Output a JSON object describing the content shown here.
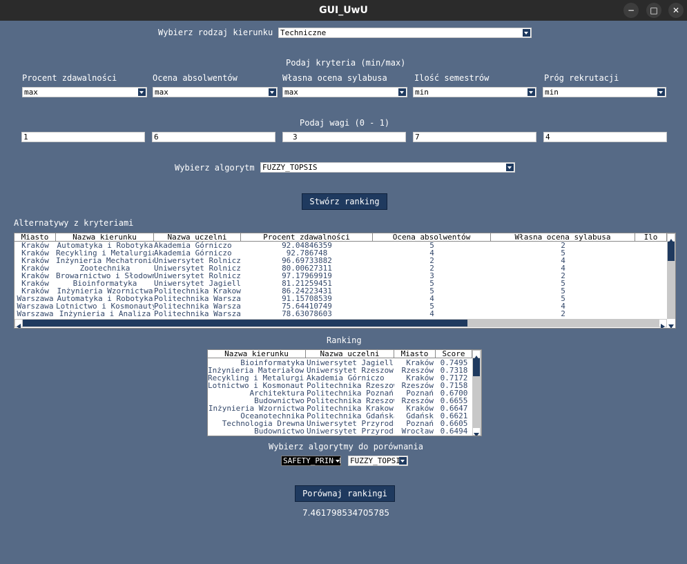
{
  "window": {
    "title": "GUI_UwU",
    "minimize": "−",
    "maximize": "□",
    "close": "✕"
  },
  "course_type": {
    "label": "Wybierz rodzaj kierunku",
    "value": "Techniczne"
  },
  "criteria": {
    "header": "Podaj kryteria (min/max)",
    "items": [
      {
        "label": "Procent zdawalności",
        "value": "max"
      },
      {
        "label": "Ocena absolwentów",
        "value": "max"
      },
      {
        "label": "Własna ocena sylabusa",
        "value": "max"
      },
      {
        "label": "Ilość semestrów",
        "value": "min"
      },
      {
        "label": "Próg rekrutacji",
        "value": "min"
      }
    ]
  },
  "weights": {
    "header": "Podaj wagi (0 - 1)",
    "values": [
      "1",
      "6",
      "3",
      "7",
      "4"
    ]
  },
  "algorithm": {
    "label": "Wybierz algorytm",
    "value": "FUZZY_TOPSIS"
  },
  "create_button": "Stwórz ranking",
  "alternatives": {
    "label": "Alternatywy z kryteriami",
    "columns": [
      "Miasto",
      "Nazwa kierunku",
      "Nazwa uczelni",
      "Procent zdawalności",
      "Ocena absolwentów",
      "Własna ocena sylabusa",
      "Ilo"
    ],
    "rows": [
      [
        "Kraków",
        "Automatyka i Robotyka",
        "Akademia Górniczo",
        "92.04846359",
        "5",
        "2"
      ],
      [
        "Kraków",
        "Recykling i Metalurgia",
        "Akademia Górniczo",
        "92.786748",
        "4",
        "5"
      ],
      [
        "Kraków",
        "Inżynieria Mechatroniczna",
        "Uniwersytet Rolniczy",
        "96.69733882",
        "2",
        "4"
      ],
      [
        "Kraków",
        "Zootechnika",
        "Uniwersytet Rolniczy",
        "80.00627311",
        "2",
        "4"
      ],
      [
        "Kraków",
        "Browarnictwo i Słodownictwo",
        "Uniwersytet Rolniczy",
        "97.17969919",
        "3",
        "2"
      ],
      [
        "Kraków",
        "Bioinformatyka",
        "Uniwersytet Jagiell",
        "81.21259451",
        "5",
        "5"
      ],
      [
        "Kraków",
        "Inżynieria Wzornictwa",
        "Politechnika Krakowska",
        "86.24223431",
        "5",
        "5"
      ],
      [
        "Warszawa",
        "Automatyka i Robotyka",
        "Politechnika Warszawska",
        "91.15708539",
        "4",
        "5"
      ],
      [
        "Warszawa",
        "Lotnictwo i Kosmonautyka",
        "Politechnika Warszawska",
        "75.64410749",
        "5",
        "4"
      ],
      [
        "Warszawa",
        "Inżynieria i Analiza",
        "Politechnika Warszawska",
        "78.63078603",
        "4",
        "2"
      ]
    ]
  },
  "ranking": {
    "label": "Ranking",
    "columns": [
      "Nazwa kierunku",
      "Nazwa uczelni",
      "Miasto",
      "Score"
    ],
    "rows": [
      [
        "Bioinformatyka",
        "Uniwersytet Jagiell",
        "Kraków",
        "0.7495"
      ],
      [
        "Inżynieria Materiałowa",
        "Uniwersytet Rzeszowski",
        "Rzeszów",
        "0.7318"
      ],
      [
        "Recykling i Metalurgia",
        "Akademia Górniczo",
        "Kraków",
        "0.7172"
      ],
      [
        "Lotnictwo i Kosmonautyka",
        "Politechnika Rzeszowska",
        "Rzeszów",
        "0.7158"
      ],
      [
        "Architektura",
        "Politechnika Poznańska",
        "Poznań",
        "0.6700"
      ],
      [
        "Budownictwo",
        "Politechnika Rzeszowska",
        "Rzeszów",
        "0.6655"
      ],
      [
        "Inżynieria Wzornictwa",
        "Politechnika Krakowska",
        "Kraków",
        "0.6647"
      ],
      [
        "Oceanotechnika",
        "Politechnika Gdańska",
        "Gdańsk",
        "0.6621"
      ],
      [
        "Technologia Drewna",
        "Uniwersytet Przyrodniczy",
        "Poznań",
        "0.6605"
      ],
      [
        "Budownictwo",
        "Uniwersytet Przyrodniczy",
        "Wrocław",
        "0.6494"
      ]
    ]
  },
  "compare": {
    "label": "Wybierz algorytmy do porównania",
    "algo1": "SAFETY_PRINCIPLE",
    "algo2": "FUZZY_TOPSIS",
    "button": "Porównaj rankingi",
    "result": "7.461798534705785"
  }
}
